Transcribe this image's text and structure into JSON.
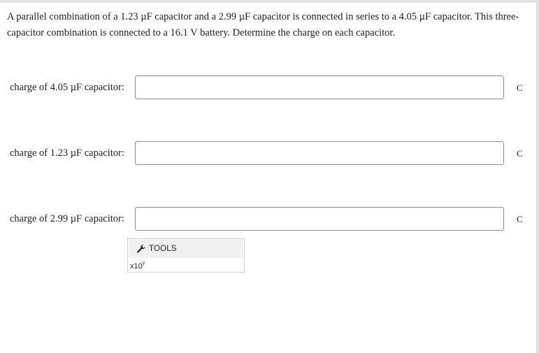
{
  "question": {
    "text": "A parallel combination of a 1.23 µF capacitor and a 2.99 µF capacitor is connected in series to a 4.05 µF capacitor. This three-capacitor combination is connected to a 16.1 V battery. Determine the charge on each capacitor."
  },
  "answers": [
    {
      "label": "charge of 4.05 µF capacitor:",
      "value": "",
      "unit": "C"
    },
    {
      "label": "charge of 1.23 µF capacitor:",
      "value": "",
      "unit": "C"
    },
    {
      "label": "charge of 2.99 µF capacitor:",
      "value": "",
      "unit": "C"
    }
  ],
  "tools": {
    "label": "TOOLS",
    "icon": "wrench-icon",
    "x10_base": "x10",
    "x10_exp": "y"
  }
}
